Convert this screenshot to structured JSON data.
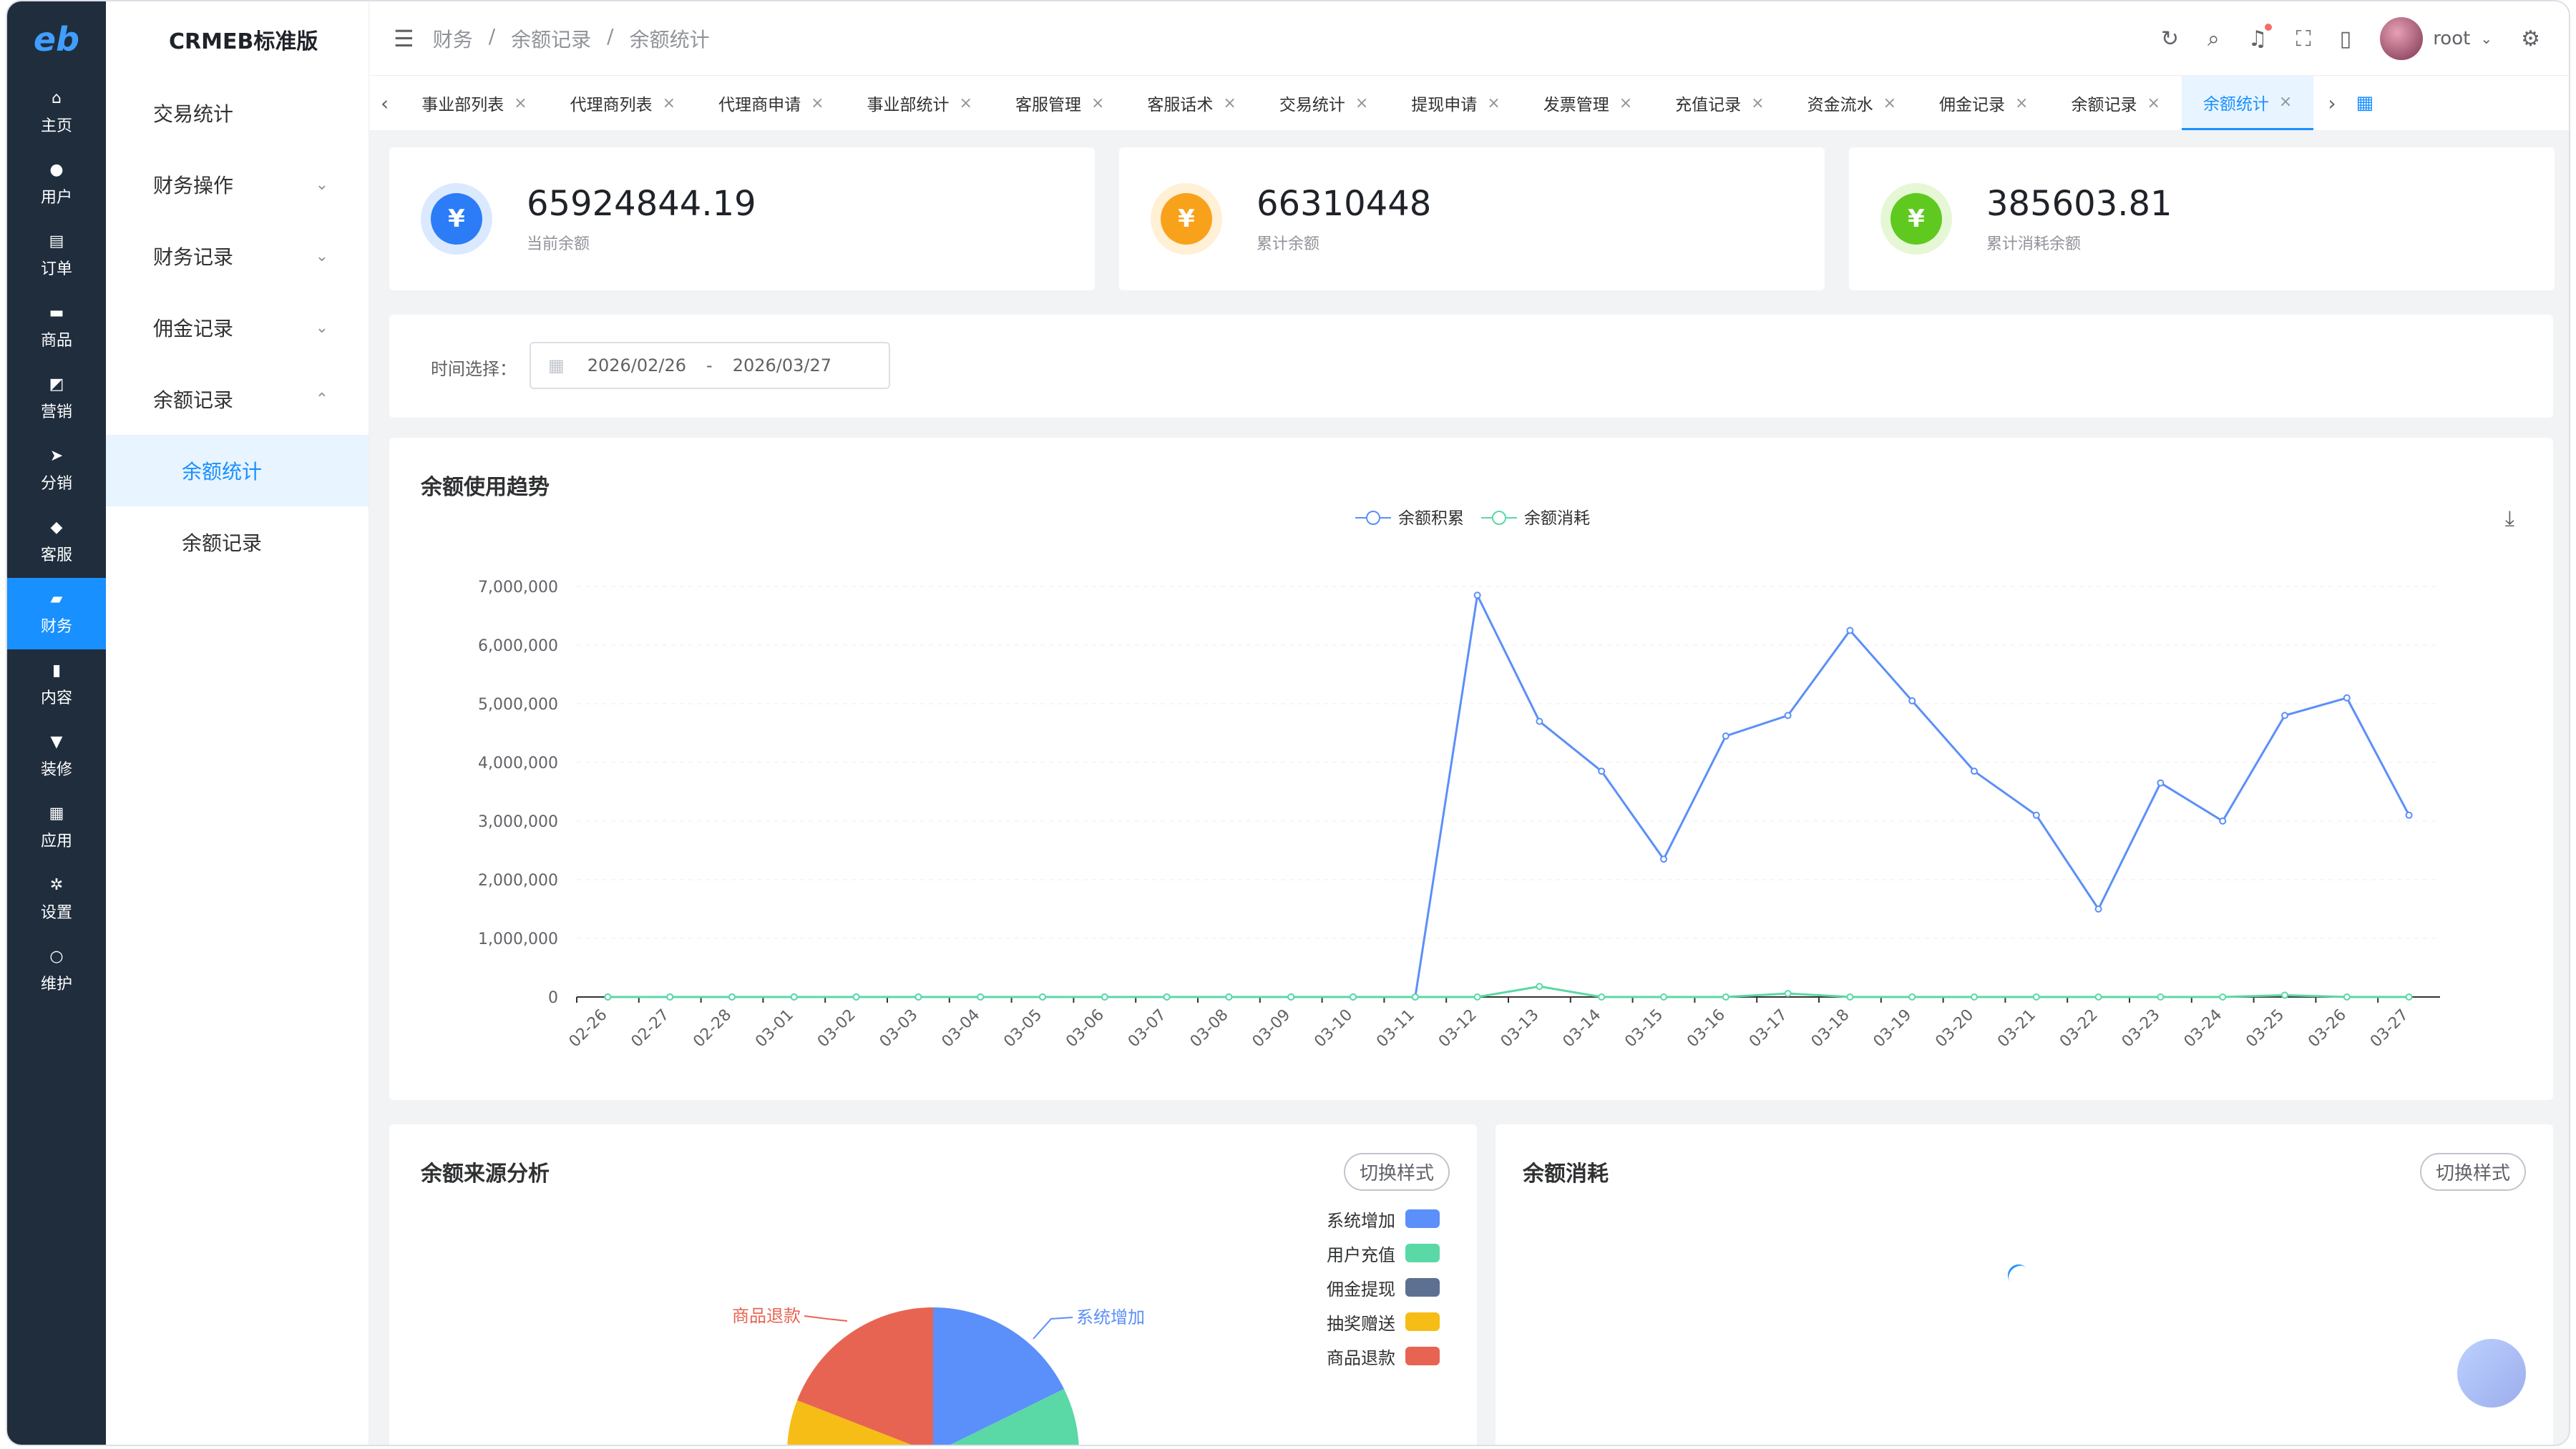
{
  "app": {
    "logo": "eb",
    "brand": "CRMEB标准版"
  },
  "rail": [
    {
      "label": "主页",
      "icon": "⌂"
    },
    {
      "label": "用户",
      "icon": "●"
    },
    {
      "label": "订单",
      "icon": "▤"
    },
    {
      "label": "商品",
      "icon": "▬"
    },
    {
      "label": "营销",
      "icon": "◩"
    },
    {
      "label": "分销",
      "icon": "➤"
    },
    {
      "label": "客服",
      "icon": "◆"
    },
    {
      "label": "财务",
      "icon": "▰"
    },
    {
      "label": "内容",
      "icon": "▮"
    },
    {
      "label": "装修",
      "icon": "▼"
    },
    {
      "label": "应用",
      "icon": "▦"
    },
    {
      "label": "设置",
      "icon": "✲"
    },
    {
      "label": "维护",
      "icon": "○"
    }
  ],
  "submenu": [
    {
      "label": "交易统计"
    },
    {
      "label": "财务操作",
      "chev": "⌄"
    },
    {
      "label": "财务记录",
      "chev": "⌄"
    },
    {
      "label": "佣金记录",
      "chev": "⌄"
    },
    {
      "label": "余额记录",
      "chev": "⌃"
    },
    {
      "label": "余额统计"
    },
    {
      "label": "余额记录"
    }
  ],
  "header": {
    "crumbs": [
      "财务",
      "/",
      "余额记录",
      "/",
      "余额统计"
    ],
    "user": "root"
  },
  "tabs": [
    "事业部列表",
    "代理商列表",
    "代理商申请",
    "事业部统计",
    "客服管理",
    "客服话术",
    "交易统计",
    "提现申请",
    "发票管理",
    "充值记录",
    "资金流水",
    "佣金记录",
    "余额记录",
    "余额统计"
  ],
  "stats": [
    {
      "value": "65924844.19",
      "label": "当前余额",
      "color": "#2b7cf6",
      "ring": "#dbe9ff"
    },
    {
      "value": "66310448",
      "label": "累计余额",
      "color": "#f8a11a",
      "ring": "#fff0d6"
    },
    {
      "value": "385603.81",
      "label": "累计消耗余额",
      "color": "#5fc91f",
      "ring": "#e6f7d6"
    }
  ],
  "filter": {
    "label": "时间选择：",
    "start": "2026/02/26",
    "sep": "-",
    "end": "2026/03/27"
  },
  "trend": {
    "title": "余额使用趋势"
  },
  "chart_data": {
    "type": "line",
    "title": "余额使用趋势",
    "x": [
      "02-26",
      "02-27",
      "02-28",
      "03-01",
      "03-02",
      "03-03",
      "03-04",
      "03-05",
      "03-06",
      "03-07",
      "03-08",
      "03-09",
      "03-10",
      "03-11",
      "03-12",
      "03-13",
      "03-14",
      "03-15",
      "03-16",
      "03-17",
      "03-18",
      "03-19",
      "03-20",
      "03-21",
      "03-22",
      "03-23",
      "03-24",
      "03-25",
      "03-26",
      "03-27"
    ],
    "series": [
      {
        "name": "余额积累",
        "color": "#5b8ff9",
        "values": [
          0,
          0,
          0,
          0,
          0,
          0,
          0,
          0,
          0,
          0,
          0,
          0,
          0,
          0,
          6850000,
          4700000,
          3850000,
          2350000,
          4450000,
          4800000,
          6250000,
          5050000,
          3850000,
          3100000,
          1500000,
          3650000,
          3000000,
          4800000,
          5100000,
          3100000
        ]
      },
      {
        "name": "余额消耗",
        "color": "#5ad8a6",
        "values": [
          0,
          0,
          0,
          0,
          0,
          0,
          0,
          0,
          0,
          0,
          0,
          0,
          0,
          0,
          0,
          180000,
          0,
          0,
          0,
          60000,
          0,
          0,
          0,
          0,
          0,
          0,
          0,
          30000,
          0,
          0
        ]
      }
    ],
    "y_ticks": [
      "0",
      "1,000,000",
      "2,000,000",
      "3,000,000",
      "4,000,000",
      "5,000,000",
      "6,000,000",
      "7,000,000"
    ],
    "ylim": [
      0,
      7000000
    ],
    "legend": "top-center"
  },
  "source": {
    "title": "余额来源分析",
    "switch": "切换样式",
    "legend": [
      {
        "label": "系统增加",
        "color": "#5b8ff9"
      },
      {
        "label": "用户充值",
        "color": "#5ad8a6"
      },
      {
        "label": "佣金提现",
        "color": "#5d7092"
      },
      {
        "label": "抽奖赠送",
        "color": "#f6bd16"
      },
      {
        "label": "商品退款",
        "color": "#e86452"
      }
    ],
    "callouts": [
      "商品退款",
      "系统增加"
    ]
  },
  "consume": {
    "title": "余额消耗",
    "switch": "切换样式"
  },
  "colors": {
    "accent": "#1890ff",
    "rail": "#1f2d3d"
  }
}
